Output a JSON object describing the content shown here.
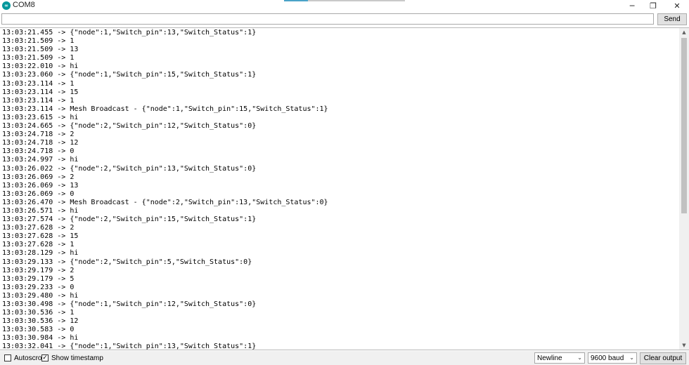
{
  "window": {
    "title": "COM8",
    "app_icon": "arduino-infinity-icon",
    "minimize_glyph": "─",
    "maximize_glyph": "❐",
    "close_glyph": "✕"
  },
  "send_row": {
    "input_value": "",
    "send_label": "Send"
  },
  "output": {
    "lines": [
      "13:03:21.455 -> {\"node\":1,\"Switch_pin\":13,\"Switch_Status\":1}",
      "13:03:21.509 -> 1",
      "13:03:21.509 -> 13",
      "13:03:21.509 -> 1",
      "13:03:22.010 -> hi",
      "13:03:23.060 -> {\"node\":1,\"Switch_pin\":15,\"Switch_Status\":1}",
      "13:03:23.114 -> 1",
      "13:03:23.114 -> 15",
      "13:03:23.114 -> 1",
      "13:03:23.114 -> Mesh Broadcast - {\"node\":1,\"Switch_pin\":15,\"Switch_Status\":1}",
      "13:03:23.615 -> hi",
      "13:03:24.665 -> {\"node\":2,\"Switch_pin\":12,\"Switch_Status\":0}",
      "13:03:24.718 -> 2",
      "13:03:24.718 -> 12",
      "13:03:24.718 -> 0",
      "13:03:24.997 -> hi",
      "13:03:26.022 -> {\"node\":2,\"Switch_pin\":13,\"Switch_Status\":0}",
      "13:03:26.069 -> 2",
      "13:03:26.069 -> 13",
      "13:03:26.069 -> 0",
      "13:03:26.470 -> Mesh Broadcast - {\"node\":2,\"Switch_pin\":13,\"Switch_Status\":0}",
      "13:03:26.571 -> hi",
      "13:03:27.574 -> {\"node\":2,\"Switch_pin\":15,\"Switch_Status\":1}",
      "13:03:27.628 -> 2",
      "13:03:27.628 -> 15",
      "13:03:27.628 -> 1",
      "13:03:28.129 -> hi",
      "13:03:29.133 -> {\"node\":2,\"Switch_pin\":5,\"Switch_Status\":0}",
      "13:03:29.179 -> 2",
      "13:03:29.179 -> 5",
      "13:03:29.233 -> 0",
      "13:03:29.480 -> hi",
      "13:03:30.498 -> {\"node\":1,\"Switch_pin\":12,\"Switch_Status\":0}",
      "13:03:30.536 -> 1",
      "13:03:30.536 -> 12",
      "13:03:30.583 -> 0",
      "13:03:30.984 -> hi",
      "13:03:32.041 -> {\"node\":1,\"Switch_pin\":13,\"Switch_Status\":1}"
    ]
  },
  "bottom_bar": {
    "autoscroll_label": "Autoscroll",
    "autoscroll_checked": false,
    "timestamp_label": "Show timestamp",
    "timestamp_checked": true,
    "check_glyph": "✓",
    "line_ending": "Newline",
    "baud_rate": "9600 baud",
    "clear_label": "Clear output",
    "chevron_glyph": "⌄"
  },
  "colors": {
    "accent": "#00979c",
    "button_bg": "#e1e1e1",
    "bar_bg": "#f0f0f0"
  }
}
